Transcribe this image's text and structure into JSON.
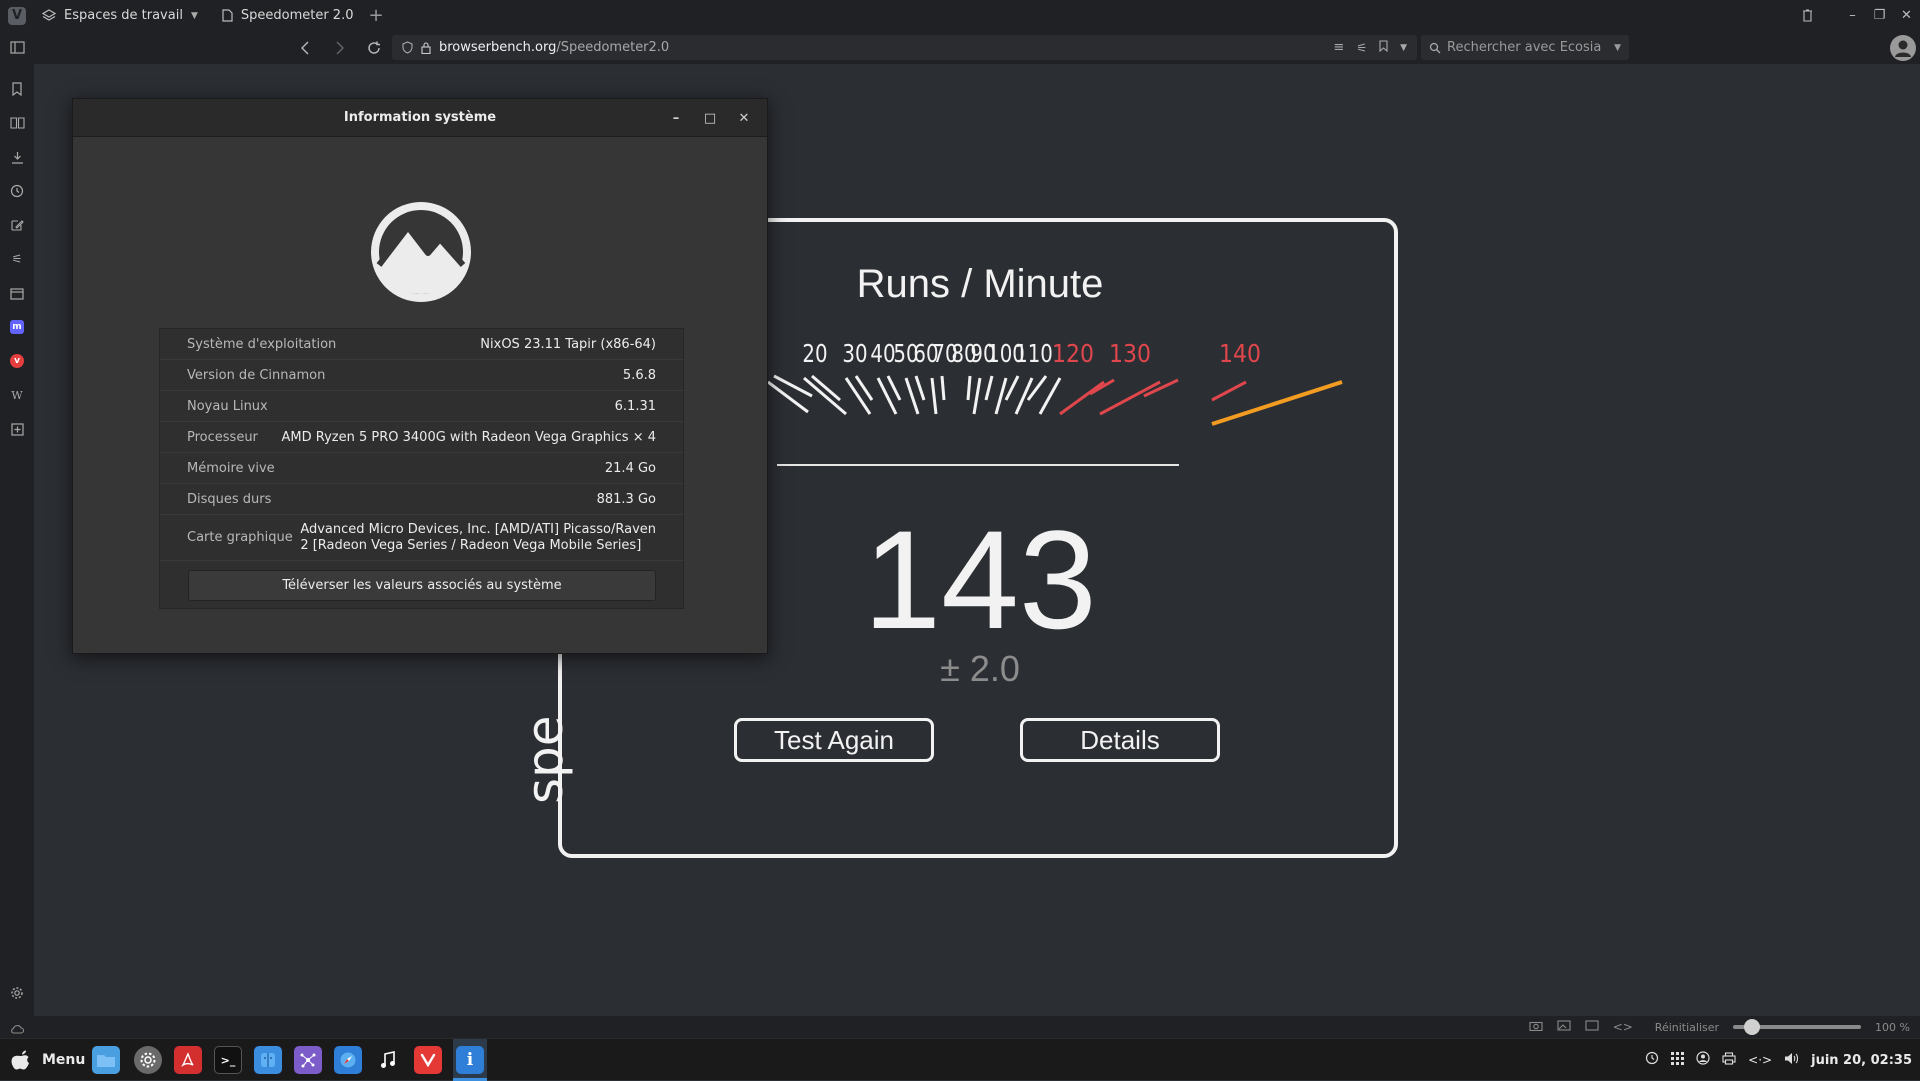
{
  "browser": {
    "workspaces_label": "Espaces de travail",
    "tab_title": "Speedometer 2.0",
    "url_host": "browserbench.org",
    "url_path": "/Speedometer2.0",
    "search_placeholder": "Rechercher avec Ecosia"
  },
  "speedometer": {
    "brand": "spe",
    "title": "Runs / Minute",
    "score": "143",
    "error": "± 2.0",
    "test_again_label": "Test Again",
    "details_label": "Details",
    "gauge_labels_white": [
      "20",
      "30",
      "40",
      "50",
      "60",
      "70",
      "80",
      "90",
      "100",
      "110"
    ],
    "gauge_labels_red": [
      "120",
      "130",
      "140"
    ]
  },
  "sysinfo": {
    "title": "Information système",
    "rows": [
      {
        "key": "Système d'exploitation",
        "value": "NixOS 23.11 Tapir (x86-64)"
      },
      {
        "key": "Version de Cinnamon",
        "value": "5.6.8"
      },
      {
        "key": "Noyau Linux",
        "value": "6.1.31"
      },
      {
        "key": "Processeur",
        "value": "AMD Ryzen 5 PRO 3400G with Radeon Vega Graphics × 4"
      },
      {
        "key": "Mémoire vive",
        "value": "21.4 Go"
      },
      {
        "key": "Disques durs",
        "value": "881.3 Go"
      },
      {
        "key": "Carte graphique",
        "value": "Advanced Micro Devices, Inc. [AMD/ATI] Picasso/Raven",
        "value2": "2 [Radeon Vega Series / Radeon Vega Mobile Series]"
      }
    ],
    "upload_label": "Téléverser les valeurs associés au système"
  },
  "statusbar": {
    "reset_label": "Réinitialiser",
    "zoom_label": "100 %",
    "zoom_level": 0.1
  },
  "taskbar": {
    "menu_label": "Menu",
    "clock": "juin 20, 02:35"
  },
  "colors": {
    "gauge_red": "#e0474c",
    "gauge_orange": "#f39c22",
    "accent_blue": "#3d8fe0"
  }
}
